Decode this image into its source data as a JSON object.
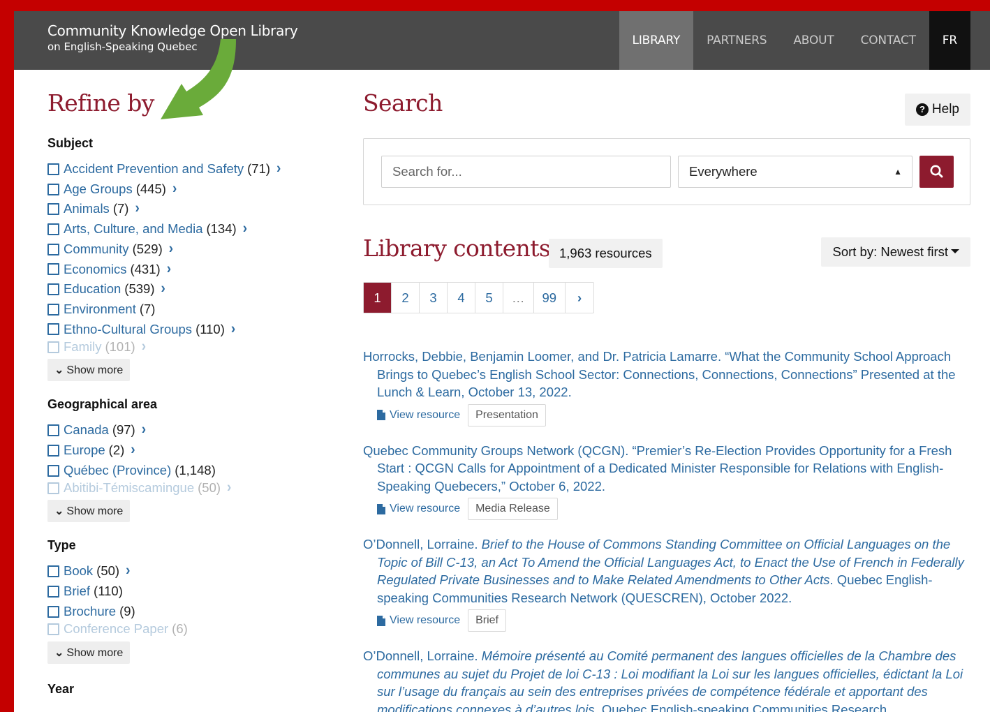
{
  "header": {
    "site_title": "Community Knowledge Open Library",
    "site_subtitle": "on English-Speaking Quebec",
    "nav": [
      {
        "label": "LIBRARY"
      },
      {
        "label": "PARTNERS"
      },
      {
        "label": "ABOUT"
      },
      {
        "label": "CONTACT"
      },
      {
        "label": "FR"
      }
    ]
  },
  "sidebar": {
    "title": "Refine by",
    "facets": {
      "subject": {
        "title": "Subject",
        "items": [
          {
            "label": "Accident Prevention and Safety",
            "count": "(71)"
          },
          {
            "label": "Age Groups",
            "count": "(445)"
          },
          {
            "label": "Animals",
            "count": "(7)"
          },
          {
            "label": "Arts, Culture, and Media",
            "count": "(134)"
          },
          {
            "label": "Community",
            "count": "(529)"
          },
          {
            "label": "Economics",
            "count": "(431)"
          },
          {
            "label": "Education",
            "count": "(539)"
          },
          {
            "label": "Environment",
            "count": "(7)"
          },
          {
            "label": "Ethno-Cultural Groups",
            "count": "(110)"
          },
          {
            "label": "Family",
            "count": "(101)"
          }
        ],
        "show_more": "Show more"
      },
      "geo": {
        "title": "Geographical area",
        "items": [
          {
            "label": "Canada",
            "count": "(97)"
          },
          {
            "label": "Europe",
            "count": "(2)"
          },
          {
            "label": "Québec (Province)",
            "count": "(1,148)"
          },
          {
            "label": "Abitibi-Témiscamingue",
            "count": "(50)"
          }
        ],
        "show_more": "Show more"
      },
      "type": {
        "title": "Type",
        "items": [
          {
            "label": "Book",
            "count": "(50)"
          },
          {
            "label": "Brief",
            "count": "(110)"
          },
          {
            "label": "Brochure",
            "count": "(9)"
          },
          {
            "label": "Conference Paper",
            "count": "(6)"
          }
        ],
        "show_more": "Show more"
      },
      "year": {
        "title": "Year"
      }
    }
  },
  "main": {
    "search_title": "Search",
    "help_label": "Help",
    "search": {
      "placeholder": "Search for...",
      "scope": "Everywhere"
    },
    "contents_title": "Library contents",
    "resource_count": "1,963 resources",
    "sort_label": "Sort by: Newest first",
    "pagination": [
      "1",
      "2",
      "3",
      "4",
      "5",
      "…",
      "99"
    ],
    "view_label": "View resource",
    "results": [
      {
        "cite": "Horrocks, Debbie, Benjamin Loomer, and Dr. Patricia Lamarre. “What the Community School Approach Brings to Quebec’s English School Sector: Connections, Connections, Connections” Presented at the Lunch & Learn, October 13, 2022.",
        "type": "Presentation"
      },
      {
        "cite": "Quebec Community Groups Network (QCGN). “Premier’s Re-Election Provides Opportunity for a Fresh Start : QCGN Calls for Appointment of a Dedicated Minister Responsible for Relations with English-Speaking Quebecers,” October 6, 2022.",
        "type": "Media Release"
      },
      {
        "cite_author": "O’Donnell, Lorraine.",
        "cite_title": "Brief to the House of Commons Standing Committee on Official Languages on the Topic of Bill C-13, an Act To Amend the Official Languages Act, to Enact the Use of French in Federally Regulated Private Businesses and to Make Related Amendments to Other Acts",
        "cite_rest": ". Quebec English-speaking Communities Research Network (QUESCREN), October 2022.",
        "type": "Brief"
      },
      {
        "cite_author": "O’Donnell, Lorraine.",
        "cite_title": "Mémoire présenté au Comité permanent des langues officielles de la Chambre des communes au sujet du Projet de loi C-13 : Loi modifiant la Loi sur les langues officielles, édictant la Loi sur l’usage du français au sein des entreprises privées de compétence fédérale et apportant des modifications connexes à d’autres lois",
        "cite_rest": ". Quebec English-speaking Communities Research"
      }
    ]
  },
  "colors": {
    "accent": "#8d1b2e",
    "link": "#2c6aa0",
    "header_bg": "#4a4a4a",
    "frame_red": "#c40000",
    "frame_yellow": "#f6b400",
    "annotation_arrow": "#6aab3a"
  },
  "icons": [
    "question-circle-icon",
    "search-icon",
    "chevron-right-icon",
    "chevron-down-icon",
    "file-icon",
    "caret-down-icon",
    "annotation-arrow"
  ]
}
